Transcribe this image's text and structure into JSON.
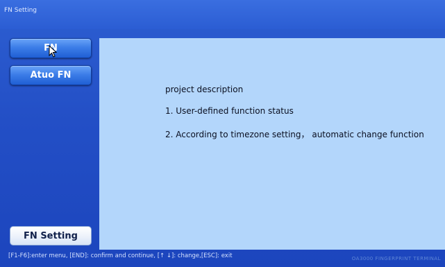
{
  "window": {
    "title": "FN Setting"
  },
  "sidebar": {
    "buttons": [
      {
        "label": "FN"
      },
      {
        "label": "Atuo FN"
      }
    ],
    "current_menu": "FN Setting"
  },
  "panel": {
    "heading": "project description",
    "items": [
      "1. User-defined function status",
      "2. According to timezone setting， automatic change function"
    ]
  },
  "footer": {
    "hint": "[F1-F6]:enter menu, [END]: confirm and continue, [↑ ↓]: change,[ESC]: exit",
    "brand": "OA3000 FINGERPRINT TERMINAL"
  },
  "colors": {
    "background": "#234fc6",
    "panel": "#b3d6fb",
    "button": "#3d7ee8"
  }
}
